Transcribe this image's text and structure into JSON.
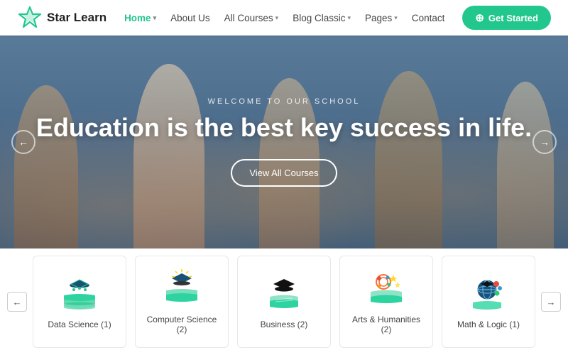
{
  "brand": {
    "name": "Star Learn"
  },
  "nav": {
    "links": [
      {
        "label": "Home",
        "active": true,
        "hasDropdown": true
      },
      {
        "label": "About Us",
        "active": false,
        "hasDropdown": false
      },
      {
        "label": "All Courses",
        "active": false,
        "hasDropdown": true
      },
      {
        "label": "Blog Classic",
        "active": false,
        "hasDropdown": true
      },
      {
        "label": "Pages",
        "active": false,
        "hasDropdown": true
      },
      {
        "label": "Contact",
        "active": false,
        "hasDropdown": false
      }
    ],
    "cta_label": "Get Started"
  },
  "hero": {
    "subtitle": "WELCOME TO OUR SCHOOL",
    "title": "Education is the best key success in life.",
    "cta_label": "View All Courses"
  },
  "categories": {
    "items": [
      {
        "label": "Data Science (1)",
        "icon": "data-science"
      },
      {
        "label": "Computer Science (2)",
        "icon": "computer-science"
      },
      {
        "label": "Business (2)",
        "icon": "business"
      },
      {
        "label": "Arts & Humanities (2)",
        "icon": "arts"
      },
      {
        "label": "Math & Logic (1)",
        "icon": "math"
      }
    ]
  }
}
